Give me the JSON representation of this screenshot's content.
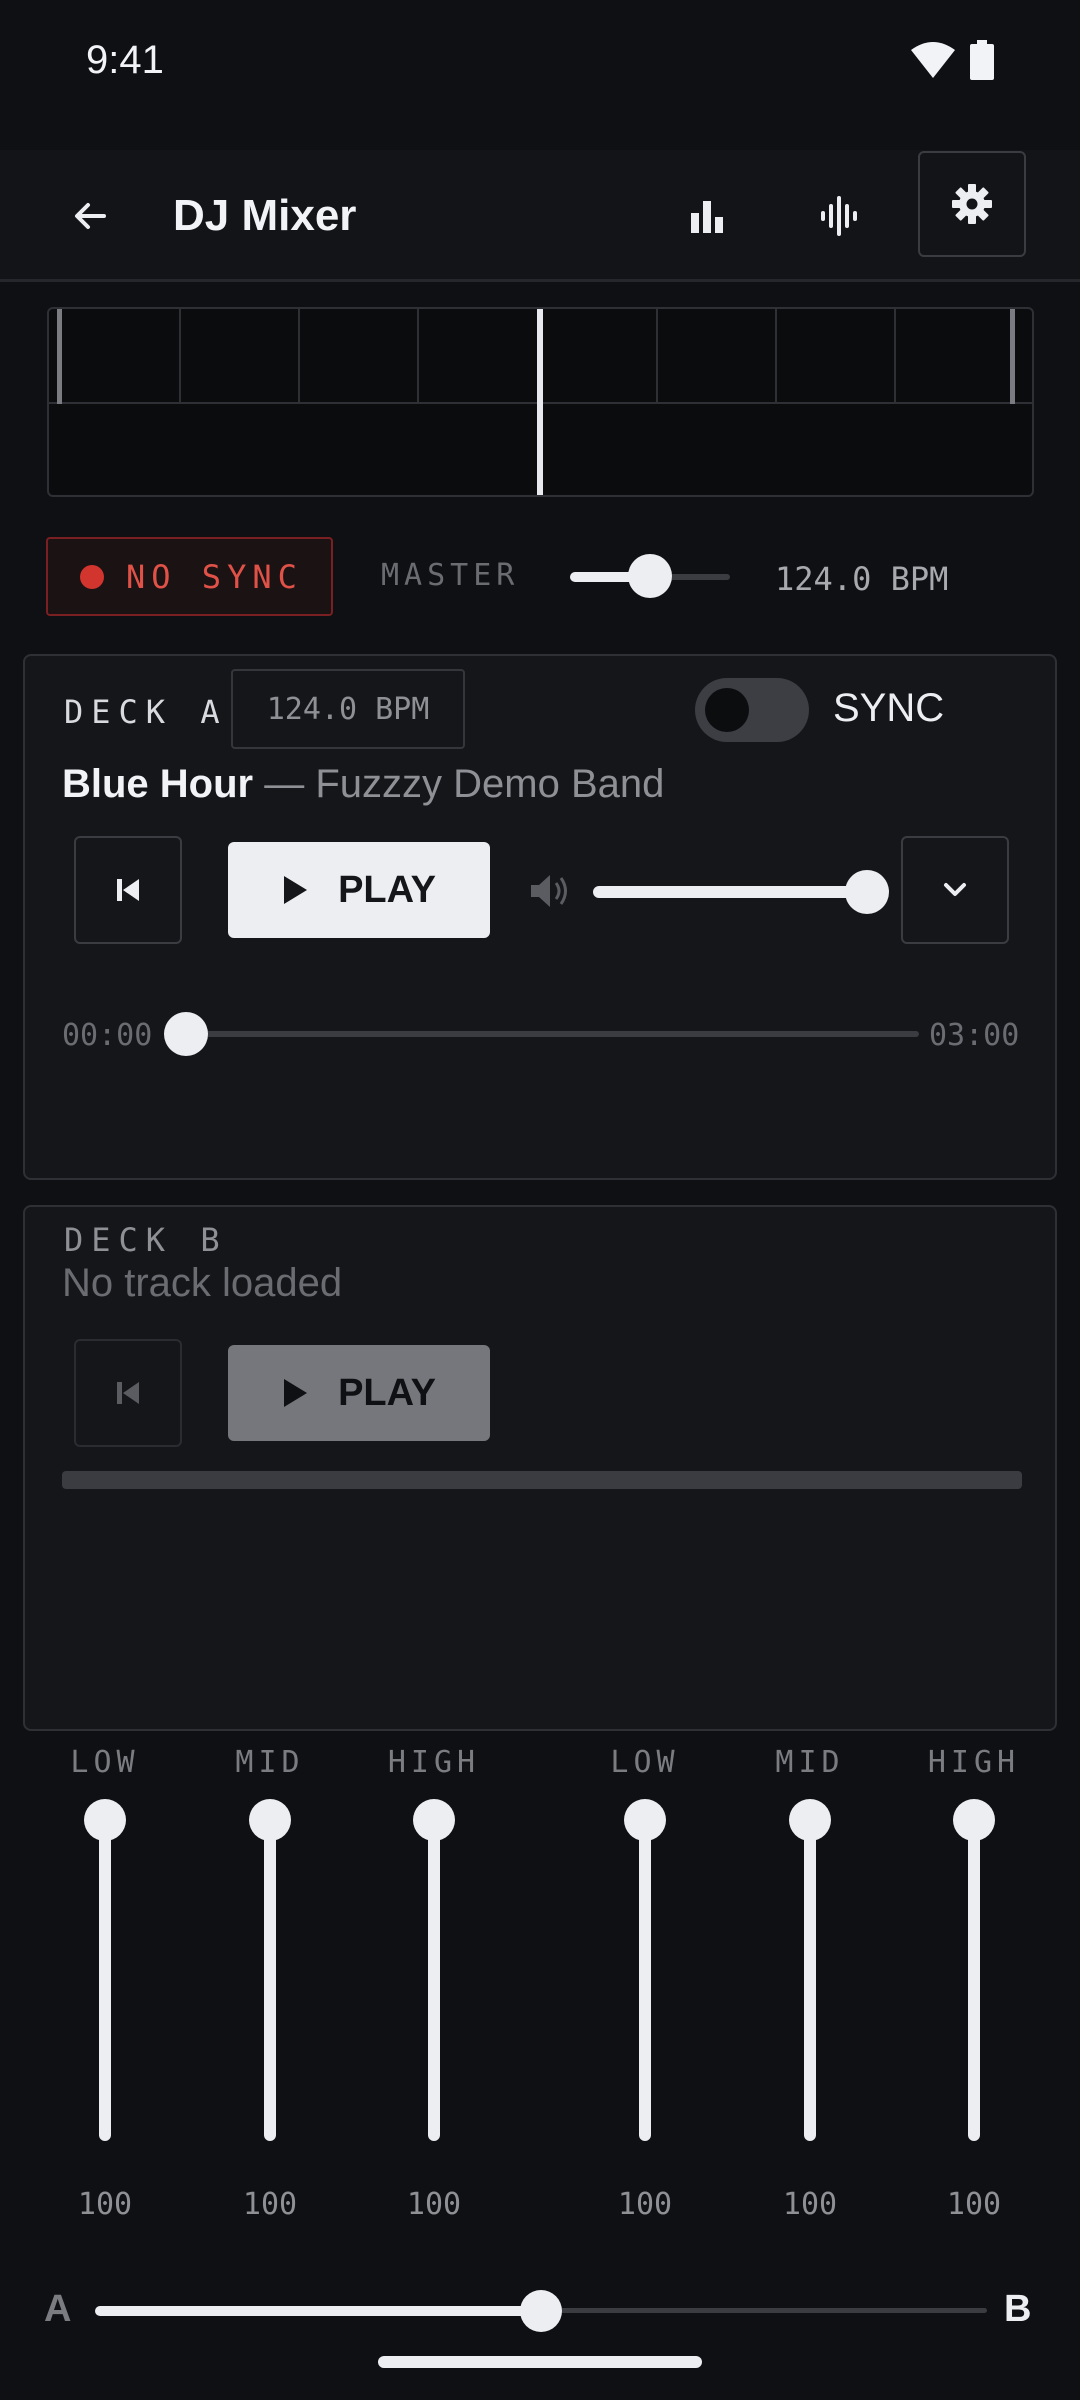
{
  "status": {
    "time": "9:41"
  },
  "appbar": {
    "title": "DJ Mixer"
  },
  "sync_bar": {
    "status": "NO SYNC",
    "master_label": "MASTER",
    "master_bpm": "124.0 BPM",
    "master_level": 0.5
  },
  "deck_a": {
    "label": "DECK A",
    "bpm": "124.0 BPM",
    "sync_label": "SYNC",
    "sync_on": false,
    "title": "Blue Hour",
    "separator": "—",
    "artist": "Fuzzzy Demo Band",
    "play_label": "PLAY",
    "volume": 1.0,
    "elapsed": "00:00",
    "duration": "03:00"
  },
  "deck_b": {
    "label": "DECK B",
    "empty_text": "No track loaded",
    "play_label": "PLAY"
  },
  "eq": [
    {
      "label": "LOW",
      "value": "100"
    },
    {
      "label": "MID",
      "value": "100"
    },
    {
      "label": "HIGH",
      "value": "100"
    },
    {
      "label": "LOW",
      "value": "100"
    },
    {
      "label": "MID",
      "value": "100"
    },
    {
      "label": "HIGH",
      "value": "100"
    }
  ],
  "crossfader": {
    "left_label": "A",
    "right_label": "B",
    "position": 0.5
  },
  "icons": [
    "wifi-icon",
    "battery-icon",
    "back-arrow-icon",
    "bar-chart-icon",
    "waveform-icon",
    "gear-icon",
    "skip-previous-icon",
    "play-icon",
    "volume-icon",
    "chevron-down-icon"
  ],
  "colors": {
    "background": "#0f1013",
    "alert": "#d2342e",
    "accent": "#eceef2"
  }
}
